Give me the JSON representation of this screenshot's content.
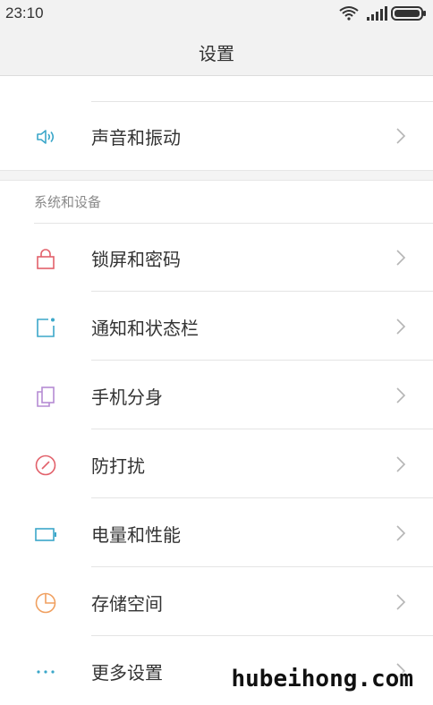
{
  "status_bar": {
    "time": "23:10",
    "icons": [
      "wifi-icon",
      "signal-icon",
      "battery-icon"
    ]
  },
  "header": {
    "title": "设置"
  },
  "top_items": [
    {
      "label": "声音和振动",
      "icon": "speaker-icon",
      "icon_color": "#3ba7c9"
    }
  ],
  "section": {
    "title": "系统和设备",
    "items": [
      {
        "label": "锁屏和密码",
        "icon": "lock-icon",
        "icon_color": "#e2606a"
      },
      {
        "label": "通知和状态栏",
        "icon": "notification-icon",
        "icon_color": "#3ba7c9"
      },
      {
        "label": "手机分身",
        "icon": "dual-space-icon",
        "icon_color": "#b58bd3"
      },
      {
        "label": "防打扰",
        "icon": "do-not-disturb-icon",
        "icon_color": "#e2606a"
      },
      {
        "label": "电量和性能",
        "icon": "battery-performance-icon",
        "icon_color": "#3ba7c9"
      },
      {
        "label": "存储空间",
        "icon": "storage-icon",
        "icon_color": "#f0a060"
      },
      {
        "label": "更多设置",
        "icon": "more-icon",
        "icon_color": "#3ba7c9"
      }
    ]
  },
  "watermark": "hubeihong.com"
}
